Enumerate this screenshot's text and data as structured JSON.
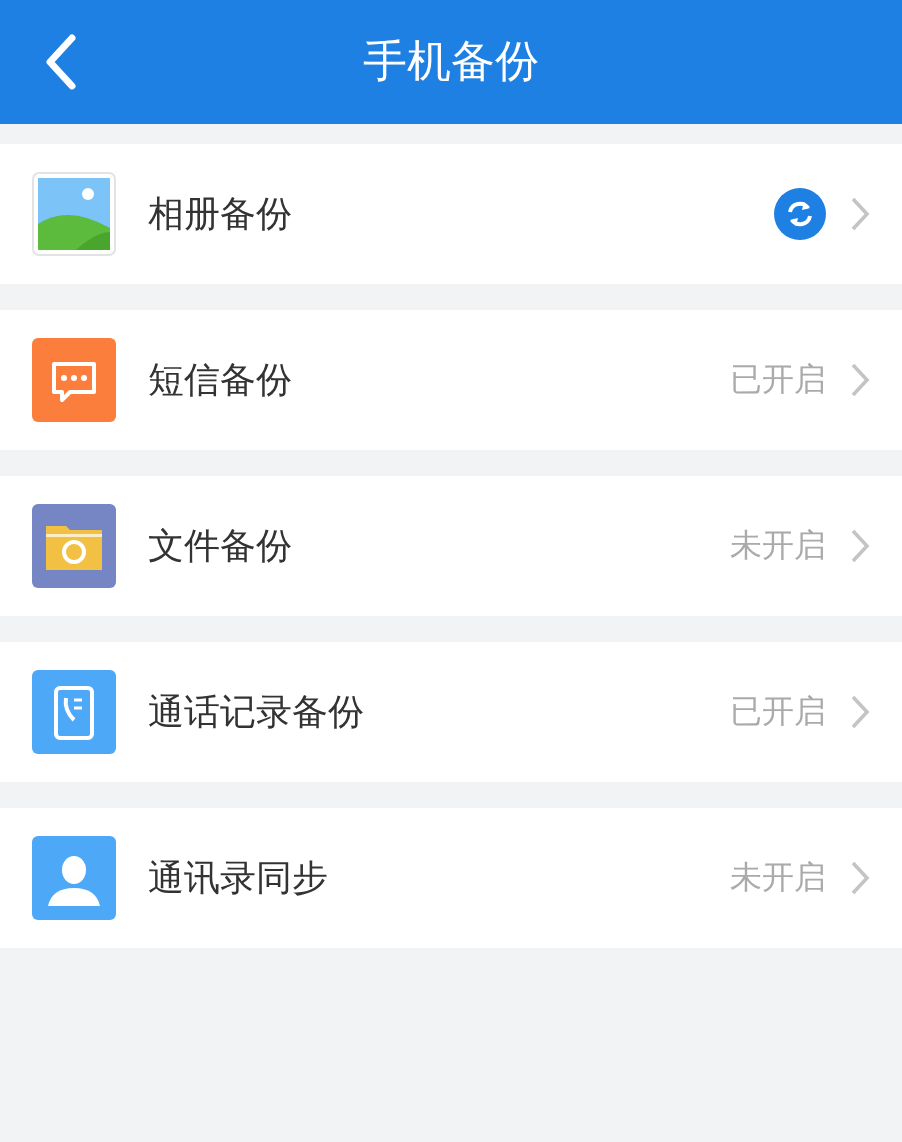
{
  "header": {
    "title": "手机备份"
  },
  "items": [
    {
      "kind": "album",
      "label": "相册备份",
      "syncing": true
    },
    {
      "kind": "sms",
      "label": "短信备份",
      "syncing": false,
      "status": "已开启"
    },
    {
      "kind": "file",
      "label": "文件备份",
      "syncing": false,
      "status": "未开启"
    },
    {
      "kind": "calls",
      "label": "通话记录备份",
      "syncing": false,
      "status": "已开启"
    },
    {
      "kind": "contacts",
      "label": "通讯录同步",
      "syncing": false,
      "status": "未开启"
    }
  ]
}
